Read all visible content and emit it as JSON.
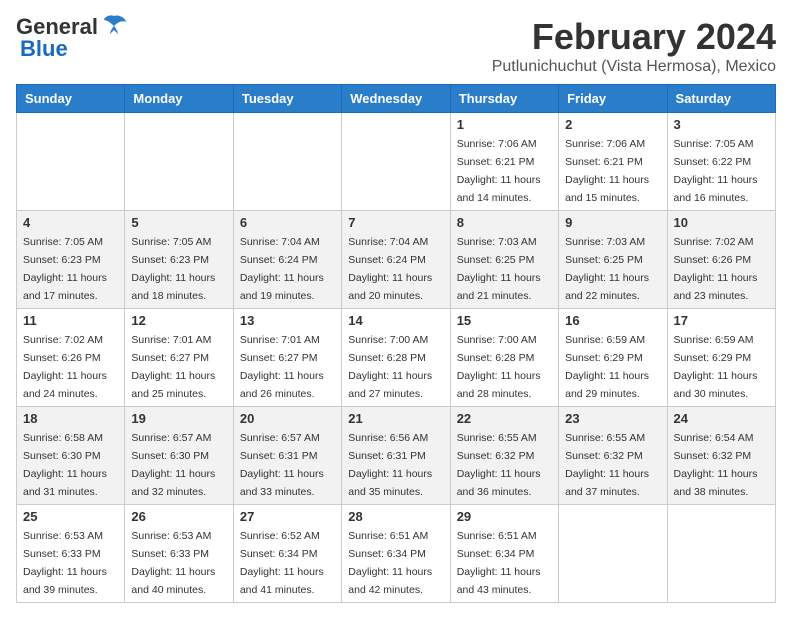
{
  "logo": {
    "general": "General",
    "blue": "Blue"
  },
  "title": "February 2024",
  "subtitle": "Putlunichuchut (Vista Hermosa), Mexico",
  "days_of_week": [
    "Sunday",
    "Monday",
    "Tuesday",
    "Wednesday",
    "Thursday",
    "Friday",
    "Saturday"
  ],
  "weeks": [
    [
      {
        "day": "",
        "info": ""
      },
      {
        "day": "",
        "info": ""
      },
      {
        "day": "",
        "info": ""
      },
      {
        "day": "",
        "info": ""
      },
      {
        "day": "1",
        "info": "Sunrise: 7:06 AM\nSunset: 6:21 PM\nDaylight: 11 hours and 14 minutes."
      },
      {
        "day": "2",
        "info": "Sunrise: 7:06 AM\nSunset: 6:21 PM\nDaylight: 11 hours and 15 minutes."
      },
      {
        "day": "3",
        "info": "Sunrise: 7:05 AM\nSunset: 6:22 PM\nDaylight: 11 hours and 16 minutes."
      }
    ],
    [
      {
        "day": "4",
        "info": "Sunrise: 7:05 AM\nSunset: 6:23 PM\nDaylight: 11 hours and 17 minutes."
      },
      {
        "day": "5",
        "info": "Sunrise: 7:05 AM\nSunset: 6:23 PM\nDaylight: 11 hours and 18 minutes."
      },
      {
        "day": "6",
        "info": "Sunrise: 7:04 AM\nSunset: 6:24 PM\nDaylight: 11 hours and 19 minutes."
      },
      {
        "day": "7",
        "info": "Sunrise: 7:04 AM\nSunset: 6:24 PM\nDaylight: 11 hours and 20 minutes."
      },
      {
        "day": "8",
        "info": "Sunrise: 7:03 AM\nSunset: 6:25 PM\nDaylight: 11 hours and 21 minutes."
      },
      {
        "day": "9",
        "info": "Sunrise: 7:03 AM\nSunset: 6:25 PM\nDaylight: 11 hours and 22 minutes."
      },
      {
        "day": "10",
        "info": "Sunrise: 7:02 AM\nSunset: 6:26 PM\nDaylight: 11 hours and 23 minutes."
      }
    ],
    [
      {
        "day": "11",
        "info": "Sunrise: 7:02 AM\nSunset: 6:26 PM\nDaylight: 11 hours and 24 minutes."
      },
      {
        "day": "12",
        "info": "Sunrise: 7:01 AM\nSunset: 6:27 PM\nDaylight: 11 hours and 25 minutes."
      },
      {
        "day": "13",
        "info": "Sunrise: 7:01 AM\nSunset: 6:27 PM\nDaylight: 11 hours and 26 minutes."
      },
      {
        "day": "14",
        "info": "Sunrise: 7:00 AM\nSunset: 6:28 PM\nDaylight: 11 hours and 27 minutes."
      },
      {
        "day": "15",
        "info": "Sunrise: 7:00 AM\nSunset: 6:28 PM\nDaylight: 11 hours and 28 minutes."
      },
      {
        "day": "16",
        "info": "Sunrise: 6:59 AM\nSunset: 6:29 PM\nDaylight: 11 hours and 29 minutes."
      },
      {
        "day": "17",
        "info": "Sunrise: 6:59 AM\nSunset: 6:29 PM\nDaylight: 11 hours and 30 minutes."
      }
    ],
    [
      {
        "day": "18",
        "info": "Sunrise: 6:58 AM\nSunset: 6:30 PM\nDaylight: 11 hours and 31 minutes."
      },
      {
        "day": "19",
        "info": "Sunrise: 6:57 AM\nSunset: 6:30 PM\nDaylight: 11 hours and 32 minutes."
      },
      {
        "day": "20",
        "info": "Sunrise: 6:57 AM\nSunset: 6:31 PM\nDaylight: 11 hours and 33 minutes."
      },
      {
        "day": "21",
        "info": "Sunrise: 6:56 AM\nSunset: 6:31 PM\nDaylight: 11 hours and 35 minutes."
      },
      {
        "day": "22",
        "info": "Sunrise: 6:55 AM\nSunset: 6:32 PM\nDaylight: 11 hours and 36 minutes."
      },
      {
        "day": "23",
        "info": "Sunrise: 6:55 AM\nSunset: 6:32 PM\nDaylight: 11 hours and 37 minutes."
      },
      {
        "day": "24",
        "info": "Sunrise: 6:54 AM\nSunset: 6:32 PM\nDaylight: 11 hours and 38 minutes."
      }
    ],
    [
      {
        "day": "25",
        "info": "Sunrise: 6:53 AM\nSunset: 6:33 PM\nDaylight: 11 hours and 39 minutes."
      },
      {
        "day": "26",
        "info": "Sunrise: 6:53 AM\nSunset: 6:33 PM\nDaylight: 11 hours and 40 minutes."
      },
      {
        "day": "27",
        "info": "Sunrise: 6:52 AM\nSunset: 6:34 PM\nDaylight: 11 hours and 41 minutes."
      },
      {
        "day": "28",
        "info": "Sunrise: 6:51 AM\nSunset: 6:34 PM\nDaylight: 11 hours and 42 minutes."
      },
      {
        "day": "29",
        "info": "Sunrise: 6:51 AM\nSunset: 6:34 PM\nDaylight: 11 hours and 43 minutes."
      },
      {
        "day": "",
        "info": ""
      },
      {
        "day": "",
        "info": ""
      }
    ]
  ]
}
